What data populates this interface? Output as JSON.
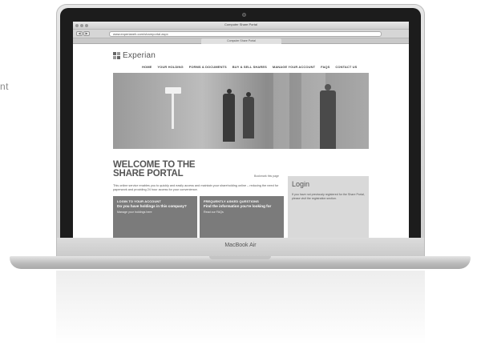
{
  "left_caption": "nt",
  "laptop": {
    "model": "MacBook Air"
  },
  "browser": {
    "window_title": "Computer Share Portal",
    "url_domain": "www.experianeh.com",
    "url_rest": "/shareportal.aspx",
    "tab_label": "Computer Share Portal",
    "back_glyph": "◀",
    "forward_glyph": "▶"
  },
  "site": {
    "logo_text": "Experian",
    "nav": [
      "HOME",
      "YOUR HOLDING",
      "FORMS & DOCUMENTS",
      "BUY & SELL SHARES",
      "MANAGE YOUR ACCOUNT",
      "FAQS",
      "CONTACT US"
    ],
    "welcome_line1": "WELCOME TO THE",
    "welcome_line2": "SHARE PORTAL",
    "share_link": "Bookmark this page",
    "intro_text": "This online service enables you to quickly and easily access and maintain your shareholding online – reducing the need for paperwork and providing 24 hour access for your convenience.",
    "box_login": {
      "kicker": "LOGIN TO YOUR ACCOUNT",
      "heading": "Do you have holdings in this company?",
      "link": "Manage your holdings here"
    },
    "box_faq": {
      "kicker": "FREQUENTLY ASKED QUESTIONS",
      "heading": "Find the information you're looking for",
      "link": "Read our FAQs"
    },
    "login_panel": {
      "title": "Login",
      "text": "If you have not previously registered for the Share Portal, please visit the registration section."
    }
  }
}
